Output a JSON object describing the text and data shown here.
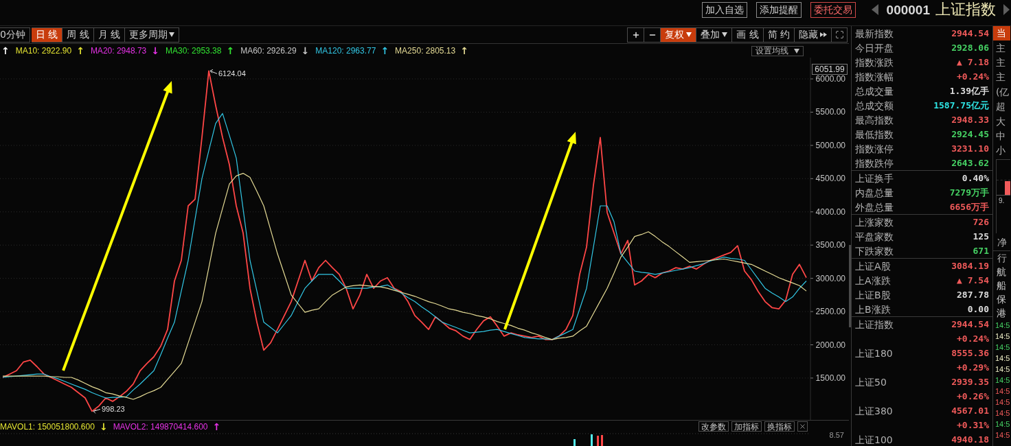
{
  "header": {
    "actions": [
      {
        "label": "加入自选",
        "kind": "plain"
      },
      {
        "label": "添加提醒",
        "kind": "plain"
      },
      {
        "label": "委托交易",
        "kind": "trade"
      }
    ],
    "code": "000001",
    "name": "上证指数"
  },
  "period_tabs": [
    {
      "label": "0分钟",
      "selected": false,
      "dropdown": false
    },
    {
      "label": "日 线",
      "selected": true,
      "dropdown": false
    },
    {
      "label": "周 线",
      "selected": false,
      "dropdown": false
    },
    {
      "label": "月 线",
      "selected": false,
      "dropdown": false
    },
    {
      "label": "更多周期",
      "selected": false,
      "dropdown": true
    }
  ],
  "chart_tools": [
    {
      "kind": "zoom-in"
    },
    {
      "kind": "zoom-out"
    },
    {
      "kind": "text",
      "label": "复权",
      "selected": true,
      "dropdown": true,
      "expand": false
    },
    {
      "kind": "text",
      "label": "叠加",
      "selected": false,
      "dropdown": true,
      "expand": false
    },
    {
      "kind": "text",
      "label": "画 线",
      "selected": false,
      "dropdown": false,
      "expand": false
    },
    {
      "kind": "text",
      "label": "简 约",
      "selected": false,
      "dropdown": false,
      "expand": false
    },
    {
      "kind": "text",
      "label": "隐藏",
      "selected": false,
      "dropdown": false,
      "expand": true
    },
    {
      "kind": "fullscreen"
    }
  ],
  "ma_legend": {
    "items": [
      {
        "arrow": "↑",
        "color": "#ffffff"
      },
      {
        "text": "MA10: 2922.90",
        "arrow": "↑",
        "color": "#e6e632"
      },
      {
        "text": "MA20: 2948.73",
        "arrow": "↓",
        "color": "#e632e6"
      },
      {
        "text": "MA30: 2953.38",
        "arrow": "↑",
        "color": "#32e632"
      },
      {
        "text": "MA60: 2926.29",
        "arrow": "↓",
        "color": "#c8c8c8"
      },
      {
        "text": "MA120: 2963.77",
        "arrow": "↑",
        "color": "#32c8e6"
      },
      {
        "text": "MA250: 2805.13",
        "arrow": "↑",
        "color": "#e6dc96"
      }
    ],
    "settings_button": "设置均线"
  },
  "price_chart": {
    "y_axis_marker": "6051.99",
    "chart_data": {
      "type": "line",
      "series": [
        {
          "color": "#ff4646",
          "values": [
            1510,
            1560,
            1610,
            1740,
            1770,
            1670,
            1560,
            1510,
            1460,
            1410,
            1360,
            1280,
            1200,
            1000,
            1080,
            1200,
            1150,
            1220,
            1300,
            1410,
            1610,
            1720,
            1820,
            1980,
            2230,
            2960,
            3270,
            4090,
            4190,
            5120,
            6120,
            5600,
            5120,
            4710,
            4090,
            3680,
            2850,
            2340,
            1920,
            2030,
            2230,
            2440,
            2650,
            2960,
            3270,
            2960,
            3160,
            3270,
            3160,
            3060,
            2850,
            2540,
            2750,
            3060,
            2850,
            2960,
            3010,
            2850,
            2800,
            2650,
            2440,
            2340,
            2230,
            2420,
            2340,
            2250,
            2210,
            2130,
            2080,
            2230,
            2360,
            2420,
            2280,
            2130,
            2180,
            2150,
            2130,
            2110,
            2130,
            2080,
            2080,
            2130,
            2230,
            2440,
            3060,
            3470,
            4400,
            5120,
            3990,
            3680,
            3370,
            3570,
            2900,
            2960,
            3060,
            3010,
            3080,
            3110,
            3160,
            3140,
            3180,
            3140,
            3210,
            3270,
            3310,
            3350,
            3390,
            3490,
            3110,
            2980,
            2800,
            2650,
            2560,
            2540,
            2670,
            3060,
            3210,
            3010
          ]
        },
        {
          "color": "#32c8e6",
          "values": [
            1510,
            1520,
            1530,
            1540,
            1550,
            1560,
            1560,
            1520,
            1490,
            1450,
            1410,
            1370,
            1330,
            1280,
            1240,
            1200,
            1210,
            1210,
            1220,
            1320,
            1410,
            1510,
            1610,
            1850,
            2100,
            2340,
            2810,
            3270,
            3890,
            4500,
            4920,
            5330,
            5480,
            5150,
            4810,
            4040,
            3270,
            2810,
            2340,
            2260,
            2180,
            2310,
            2440,
            2650,
            2850,
            2960,
            3060,
            3060,
            3060,
            2960,
            2850,
            2850,
            2850,
            2850,
            2870,
            2880,
            2900,
            2840,
            2780,
            2710,
            2650,
            2570,
            2500,
            2420,
            2340,
            2300,
            2260,
            2220,
            2180,
            2190,
            2200,
            2220,
            2230,
            2200,
            2170,
            2140,
            2110,
            2100,
            2090,
            2090,
            2080,
            2130,
            2180,
            2230,
            2540,
            2850,
            3470,
            4090,
            4090,
            3850,
            3370,
            3240,
            3110,
            3090,
            3080,
            3060,
            3080,
            3100,
            3120,
            3140,
            3160,
            3190,
            3220,
            3260,
            3290,
            3320,
            3300,
            3290,
            3270,
            3130,
            2990,
            2850,
            2780,
            2720,
            2650,
            2720,
            2850,
            2960
          ]
        },
        {
          "color": "#e6dc96",
          "values": [
            1530,
            1530,
            1530,
            1530,
            1530,
            1530,
            1530,
            1520,
            1520,
            1510,
            1510,
            1470,
            1420,
            1370,
            1330,
            1280,
            1260,
            1230,
            1210,
            1180,
            1220,
            1270,
            1310,
            1360,
            1480,
            1600,
            1720,
            2030,
            2340,
            2650,
            3160,
            3680,
            4050,
            4420,
            4540,
            4580,
            4520,
            4310,
            4090,
            3730,
            3370,
            3060,
            2750,
            2620,
            2490,
            2520,
            2540,
            2650,
            2750,
            2810,
            2870,
            2890,
            2900,
            2890,
            2880,
            2870,
            2850,
            2820,
            2790,
            2760,
            2730,
            2690,
            2650,
            2620,
            2580,
            2540,
            2520,
            2490,
            2470,
            2440,
            2420,
            2390,
            2350,
            2320,
            2290,
            2250,
            2220,
            2180,
            2150,
            2110,
            2080,
            2100,
            2110,
            2130,
            2210,
            2280,
            2470,
            2660,
            2850,
            3080,
            3320,
            3470,
            3630,
            3660,
            3700,
            3630,
            3550,
            3480,
            3400,
            3320,
            3240,
            3250,
            3260,
            3270,
            3280,
            3290,
            3270,
            3250,
            3230,
            3210,
            3160,
            3110,
            3060,
            3010,
            2970,
            2930,
            2890,
            2810
          ]
        }
      ],
      "ylim": [
        870,
        6320
      ],
      "yticks": [
        {
          "value": 1500,
          "label": "1500.00"
        },
        {
          "value": 2000,
          "label": "2000.00"
        },
        {
          "value": 2500,
          "label": "2500.00"
        },
        {
          "value": 3000,
          "label": "3000.00"
        },
        {
          "value": 3500,
          "label": "3500.00"
        },
        {
          "value": 4000,
          "label": "4000.00"
        },
        {
          "value": 4500,
          "label": "4500.00"
        },
        {
          "value": 5000,
          "label": "5000.00"
        },
        {
          "value": 5500,
          "label": "5500.00"
        },
        {
          "value": 6000,
          "label": "6000.00"
        }
      ],
      "grid": true,
      "annotations": [
        "6124.04",
        "998.23"
      ]
    }
  },
  "volume_panel": {
    "items": [
      {
        "text": "MAVOL1: 150051800.600",
        "arrow": "↓",
        "color": "#e6e632"
      },
      {
        "text": "MAVOL2: 149870414.600",
        "arrow": "↑",
        "color": "#e632e6"
      }
    ],
    "buttons": [
      "改参数",
      "加指标",
      "换指标"
    ],
    "axis_label": "8.57"
  },
  "quote_panel": {
    "groups": [
      {
        "rows": [
          {
            "label": "最新指数",
            "value": "2944.54",
            "color": "#f05a5a"
          },
          {
            "label": "今日开盘",
            "value": "2928.06",
            "color": "#46d264"
          },
          {
            "label": "指数涨跌",
            "value": "▲ 7.18",
            "color": "#f05a5a"
          },
          {
            "label": "指数涨幅",
            "value": "+0.24%",
            "color": "#f05a5a"
          },
          {
            "label": "总成交量",
            "value": "1.39亿手",
            "color": "#dcdcdc"
          },
          {
            "label": "总成交额",
            "value": "1587.75亿元",
            "color": "#2ee6e6"
          },
          {
            "label": "最高指数",
            "value": "2948.33",
            "color": "#f05a5a"
          },
          {
            "label": "最低指数",
            "value": "2924.45",
            "color": "#46d264"
          },
          {
            "label": "指数涨停",
            "value": "3231.10",
            "color": "#f05a5a"
          },
          {
            "label": "指数跌停",
            "value": "2643.62",
            "color": "#46d264"
          }
        ]
      },
      {
        "rows": [
          {
            "label": "上证换手",
            "value": "0.40%",
            "color": "#dcdcdc"
          },
          {
            "label": "内盘总量",
            "value": "7279万手",
            "color": "#46d264"
          },
          {
            "label": "外盘总量",
            "value": "6656万手",
            "color": "#f05a5a"
          }
        ]
      },
      {
        "rows": [
          {
            "label": "上涨家数",
            "value": "726",
            "color": "#f05a5a"
          },
          {
            "label": "平盘家数",
            "value": "125",
            "color": "#dcdcdc"
          },
          {
            "label": "下跌家数",
            "value": "671",
            "color": "#46d264"
          }
        ]
      },
      {
        "rows": [
          {
            "label": "上证A股",
            "value": "3084.19",
            "color": "#f05a5a"
          },
          {
            "label": "上A涨跌",
            "value": "▲ 7.54",
            "color": "#f05a5a"
          },
          {
            "label": "上证B股",
            "value": "287.78",
            "color": "#dcdcdc"
          },
          {
            "label": "上B涨跌",
            "value": "0.00",
            "color": "#dcdcdc"
          }
        ]
      },
      {
        "rows": [
          {
            "label": "上证指数",
            "value": "2944.54",
            "color": "#f05a5a"
          },
          {
            "value": "+0.24%",
            "color": "#f05a5a"
          },
          {
            "label": "上证180",
            "value": "8555.36",
            "color": "#f05a5a"
          },
          {
            "value": "+0.29%",
            "color": "#f05a5a"
          },
          {
            "label": "上证50",
            "value": "2939.35",
            "color": "#f05a5a"
          },
          {
            "value": "+0.26%",
            "color": "#f05a5a"
          },
          {
            "label": "上证380",
            "value": "4567.01",
            "color": "#f05a5a"
          },
          {
            "value": "+0.31%",
            "color": "#f05a5a"
          },
          {
            "label": "上证100",
            "value": "4940.18",
            "color": "#f05a5a"
          }
        ]
      }
    ]
  },
  "side_strip": {
    "tab": {
      "label": "当",
      "selected": true
    },
    "flow_labels": [
      "主",
      "主",
      "主",
      "(亿",
      "超",
      "大",
      "中",
      "小"
    ],
    "mini_chart_label": "9.",
    "net_label": "净",
    "sector_header": "行",
    "sectors": [
      "航",
      "船",
      "保",
      "港"
    ],
    "times": [
      {
        "text": "14:5",
        "color": "#46d264"
      },
      {
        "text": "14:5",
        "color": "#f0f0c8"
      },
      {
        "text": "14:5",
        "color": "#46d264"
      },
      {
        "text": "14:5",
        "color": "#f0f0c8"
      },
      {
        "text": "14:5",
        "color": "#f0f0c8"
      },
      {
        "text": "14:5",
        "color": "#46d264"
      },
      {
        "text": "14:5",
        "color": "#f05a5a"
      },
      {
        "text": "14:5",
        "color": "#f05a5a"
      },
      {
        "text": "14:5",
        "color": "#f05a5a"
      },
      {
        "text": "14:5",
        "color": "#46d264"
      },
      {
        "text": "14:5",
        "color": "#f05a5a"
      }
    ]
  }
}
